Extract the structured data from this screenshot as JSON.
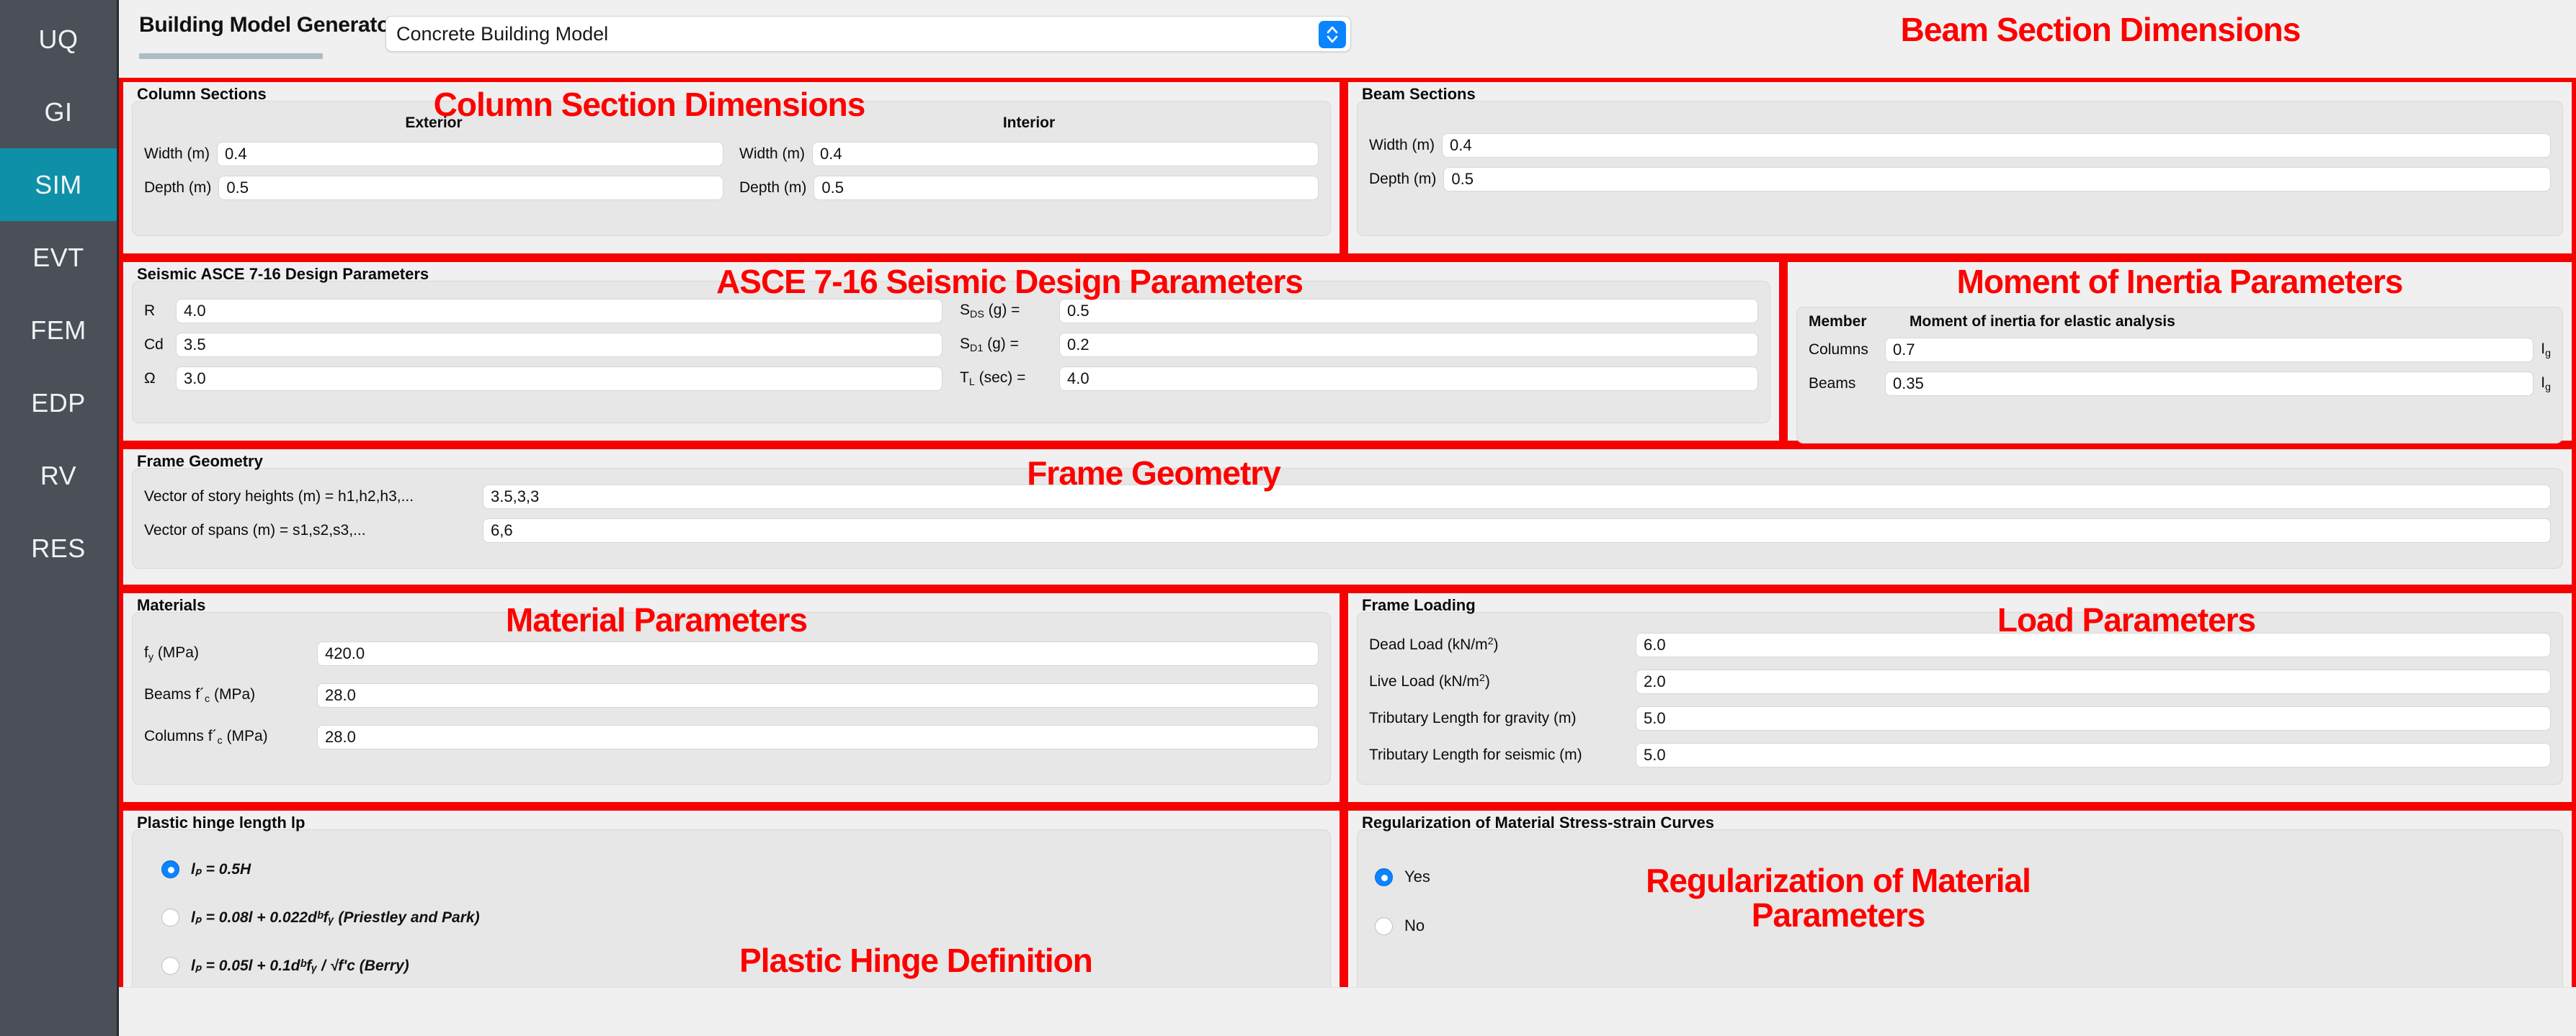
{
  "sidebar": {
    "items": [
      {
        "label": "UQ",
        "active": false
      },
      {
        "label": "GI",
        "active": false
      },
      {
        "label": "SIM",
        "active": true
      },
      {
        "label": "EVT",
        "active": false
      },
      {
        "label": "FEM",
        "active": false
      },
      {
        "label": "EDP",
        "active": false
      },
      {
        "label": "RV",
        "active": false
      },
      {
        "label": "RES",
        "active": false
      }
    ],
    "active_color": "#0d90a8",
    "background_color": "#4b5058"
  },
  "header": {
    "title": "Building Model Generator",
    "model_select_value": "Concrete Building Model",
    "select_arrow_icon": "chevron-up-down-icon"
  },
  "annotations": {
    "color": "#fe0000",
    "column_sections": "Column Section Dimensions",
    "beam_sections": "Beam Section Dimensions",
    "seismic": "ASCE 7-16 Seismic Design Parameters",
    "moment_inertia": "Moment of Inertia Parameters",
    "frame_geometry": "Frame Geometry",
    "materials": "Material Parameters",
    "loads": "Load Parameters",
    "plastic_hinge": "Plastic Hinge Definition",
    "regularization": "Regularization of Material\nParameters"
  },
  "column_sections": {
    "title": "Column Sections",
    "headers": [
      "Exterior",
      "Interior"
    ],
    "exterior": [
      {
        "label": "Width (m)",
        "value": "0.4"
      },
      {
        "label": "Depth (m)",
        "value": "0.5"
      }
    ],
    "interior": [
      {
        "label": "Width (m)",
        "value": "0.4"
      },
      {
        "label": "Depth (m)",
        "value": "0.5"
      }
    ]
  },
  "beam_sections": {
    "title": "Beam Sections",
    "fields": [
      {
        "label": "Width (m)",
        "value": "0.4"
      },
      {
        "label": "Depth (m)",
        "value": "0.5"
      }
    ]
  },
  "seismic": {
    "title": "Seismic ASCE 7-16 Design Parameters",
    "left_fields": [
      {
        "label": "R",
        "value": "4.0"
      },
      {
        "label": "Cd",
        "value": "3.5"
      },
      {
        "label": "Ω",
        "value": "3.0"
      }
    ],
    "right_fields": [
      {
        "label_main": "S",
        "label_sub": "DS",
        "label_tail": " (g) =",
        "value": "0.5"
      },
      {
        "label_main": "S",
        "label_sub": "D1",
        "label_tail": " (g) =",
        "value": "0.2"
      },
      {
        "label_main": "T",
        "label_sub": "L",
        "label_tail": " (sec) =",
        "value": "4.0"
      }
    ]
  },
  "moment_inertia": {
    "header_member": "Member",
    "header_moment": "Moment of inertia for elastic analysis",
    "rows": [
      {
        "member": "Columns",
        "value": "0.7",
        "unit_main": "I",
        "unit_sub": "g"
      },
      {
        "member": "Beams",
        "value": "0.35",
        "unit_main": "I",
        "unit_sub": "g"
      }
    ]
  },
  "frame_geometry": {
    "title": "Frame Geometry",
    "fields": [
      {
        "label": "Vector of story heights (m) = h1,h2,h3,...",
        "value": "3.5,3,3"
      },
      {
        "label": "Vector of spans (m) = s1,s2,s3,...",
        "value": "6,6"
      }
    ]
  },
  "materials": {
    "title": "Materials",
    "fields": [
      {
        "label_pre": "f",
        "label_sub": "y",
        "label_post": " (MPa)",
        "value": "420.0"
      },
      {
        "label_pre": "Beams f´",
        "label_sub": "c",
        "label_post": " (MPa)",
        "value": "28.0"
      },
      {
        "label_pre": "Columns f´",
        "label_sub": "c",
        "label_post": " (MPa)",
        "value": "28.0"
      }
    ]
  },
  "frame_loading": {
    "title": "Frame Loading",
    "fields": [
      {
        "label_pre": "Dead Load (kN/m",
        "label_sup": "2",
        "label_post": ")",
        "value": "6.0"
      },
      {
        "label_pre": "Live Load (kN/m",
        "label_sup": "2",
        "label_post": ")",
        "value": "2.0"
      },
      {
        "label_pre": "Tributary Length for gravity (m)",
        "label_sup": "",
        "label_post": "",
        "value": "5.0"
      },
      {
        "label_pre": "Tributary Length for seismic (m)",
        "label_sup": "",
        "label_post": "",
        "value": "5.0"
      }
    ]
  },
  "plastic_hinge": {
    "title": "Plastic hinge length lp",
    "options": [
      {
        "id": "lp-05h",
        "selected": true,
        "text": "lₚ = 0.5H"
      },
      {
        "id": "lp-priestley-park",
        "selected": false,
        "text": "lₚ = 0.08l + 0.022dᵇfᵧ (Priestley and Park)"
      },
      {
        "id": "lp-berry",
        "selected": false,
        "text": "lₚ = 0.05l + 0.1dᵇfᵧ / √f'ᴄ (Berry)"
      }
    ]
  },
  "regularization": {
    "title": "Regularization of Material Stress-strain Curves",
    "options": [
      {
        "id": "reg-yes",
        "label": "Yes",
        "selected": true
      },
      {
        "id": "reg-no",
        "label": "No",
        "selected": false
      }
    ]
  }
}
